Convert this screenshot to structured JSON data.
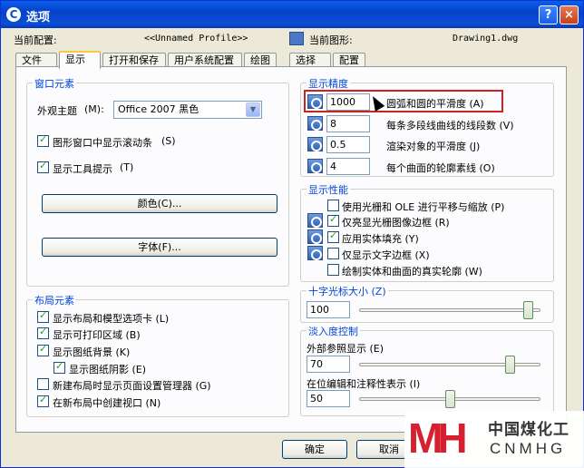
{
  "window": {
    "title": "选项",
    "app_icon": "autocad-logo-icon",
    "help_glyph": "?",
    "close_glyph": "×"
  },
  "profile": {
    "current_config_label": "当前配置:",
    "current_config_value": "<<Unnamed Profile>>",
    "current_drawing_label": "当前图形:",
    "current_drawing_value": "Drawing1.dwg"
  },
  "tabs": [
    "文件",
    "显示",
    "打开和保存",
    "用户系统配置",
    "绘图",
    "选择集",
    "配置"
  ],
  "active_tab": "显示",
  "window_elements": {
    "title": "窗口元素",
    "theme_label": "外观主题",
    "theme_key": "(M):",
    "theme_value": "Office 2007 黑色",
    "scrollbars_label": "图形窗口中显示滚动条",
    "scrollbars_key": "(S)",
    "scrollbars_checked": true,
    "tooltips_label": "显示工具提示",
    "tooltips_key": "(T)",
    "tooltips_checked": true,
    "colors_button": "颜色(C)...",
    "fonts_button": "字体(F)..."
  },
  "layout_elements": {
    "title": "布局元素",
    "items": [
      {
        "label": "显示布局和模型选项卡 (L)",
        "checked": true
      },
      {
        "label": "显示可打印区域 (B)",
        "checked": true
      },
      {
        "label": "显示图纸背景 (K)",
        "checked": true
      },
      {
        "label": "显示图纸阴影 (E)",
        "checked": true
      },
      {
        "label": "新建布局时显示页面设置管理器 (G)",
        "checked": false
      },
      {
        "label": "在新布局中创建视口 (N)",
        "checked": true
      }
    ]
  },
  "display_resolution": {
    "title": "显示精度",
    "items": [
      {
        "value": "1000",
        "label": "圆弧和圆的平滑度 (A)"
      },
      {
        "value": "8",
        "label": "每条多段线曲线的线段数 (V)"
      },
      {
        "value": "0.5",
        "label": "渲染对象的平滑度 (J)"
      },
      {
        "value": "4",
        "label": "每个曲面的轮廓素线 (O)"
      }
    ]
  },
  "display_performance": {
    "title": "显示性能",
    "items": [
      {
        "label": "使用光栅和 OLE 进行平移与缩放 (P)",
        "checked": false
      },
      {
        "label": "仅亮显光栅图像边框 (R)",
        "checked": true
      },
      {
        "label": "应用实体填充 (Y)",
        "checked": true
      },
      {
        "label": "仅显示文字边框 (X)",
        "checked": false
      },
      {
        "label": "绘制实体和曲面的真实轮廓 (W)",
        "checked": false
      }
    ]
  },
  "crosshair": {
    "title": "十字光标大小 (Z)",
    "value": "100",
    "slider_fraction": 1.0
  },
  "fade_control": {
    "title": "淡入度控制",
    "xref_label": "外部参照显示 (E)",
    "xref_value": "70",
    "xref_fraction": 0.7,
    "inplace_label": "在位编辑和注释性表示 (I)",
    "inplace_value": "50",
    "inplace_fraction": 0.5
  },
  "buttons": {
    "ok": "确定",
    "cancel": "取消"
  },
  "watermark": {
    "logo": "MH",
    "name_cn": "中国煤化工",
    "name_en": "CNMHG"
  },
  "colors": {
    "title_bar": "#0a4fd6",
    "group_title": "#0046d5",
    "highlight": "#d02020",
    "watermark_red": "#d42030"
  }
}
